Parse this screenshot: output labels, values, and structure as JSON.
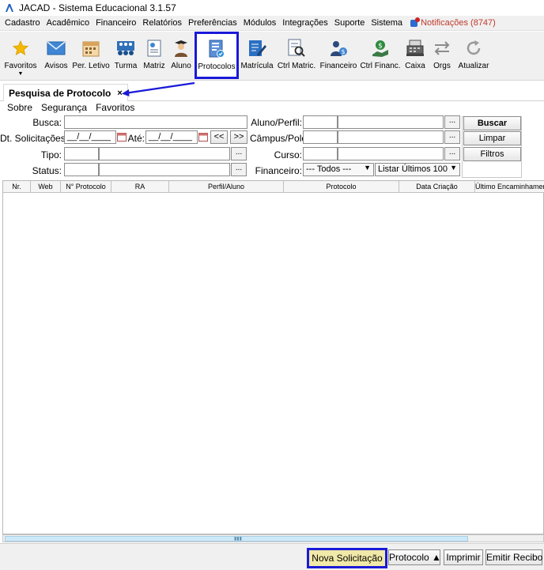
{
  "window": {
    "title": "JACAD - Sistema Educacional 3.1.57"
  },
  "menu": {
    "items": [
      "Cadastro",
      "Acadêmico",
      "Financeiro",
      "Relatórios",
      "Preferências",
      "Módulos",
      "Integrações",
      "Suporte",
      "Sistema"
    ],
    "notifications": "Notificações (8747)"
  },
  "toolbar": {
    "items": [
      "Favoritos",
      "Avisos",
      "Per. Letivo",
      "Turma",
      "Matriz",
      "Aluno",
      "Protocolos",
      "Matrícula",
      "Ctrl Matric.",
      "Financeiro",
      "Ctrl Financ.",
      "Caixa",
      "Orgs",
      "Atualizar"
    ],
    "selected": "Protocolos"
  },
  "tab": {
    "label": "Pesquisa de Protocolo",
    "close": "×"
  },
  "submenu": [
    "Sobre",
    "Segurança",
    "Favoritos"
  ],
  "form": {
    "busca_label": "Busca:",
    "dt_label": "Dt. Solicitações:",
    "dt_from": "__/__/____",
    "ate_label": "Até:",
    "dt_to": "__/__/____",
    "prev": "<<",
    "next": ">>",
    "tipo_label": "Tipo:",
    "status_label": "Status:",
    "aluno_label": "Aluno/Perfil:",
    "campus_label": "Câmpus/Polo:",
    "curso_label": "Curso:",
    "financeiro_label": "Financeiro:",
    "financeiro_value": "--- Todos ---",
    "listar_value": "Listar Últimos 100",
    "dots": "..."
  },
  "buttons": {
    "buscar": "Buscar",
    "limpar": "Limpar",
    "filtros": "Filtros"
  },
  "table": {
    "columns": [
      "Nr.",
      "Web",
      "N° Protocolo",
      "RA",
      "Perfil/Aluno",
      "Protocolo",
      "Data Criação",
      "Último Encaminhamento"
    ]
  },
  "bottom": {
    "nova": "Nova Solicitação",
    "protocolo": "Protocolo ▲",
    "imprimir": "Imprimir",
    "emitir": "Emitir Recibo"
  },
  "colors": {
    "highlight": "#1a1ad8",
    "nova_bg": "#f1e9a8",
    "notification": "#c0392b"
  },
  "icons": [
    "star-icon",
    "envelope-icon",
    "calendar-icon",
    "group-icon",
    "document-icon",
    "person-icon",
    "protocol-icon",
    "edit-icon",
    "search-doc-icon",
    "finance-person-icon",
    "money-icon",
    "cash-register-icon",
    "arrows-icon",
    "refresh-icon"
  ]
}
